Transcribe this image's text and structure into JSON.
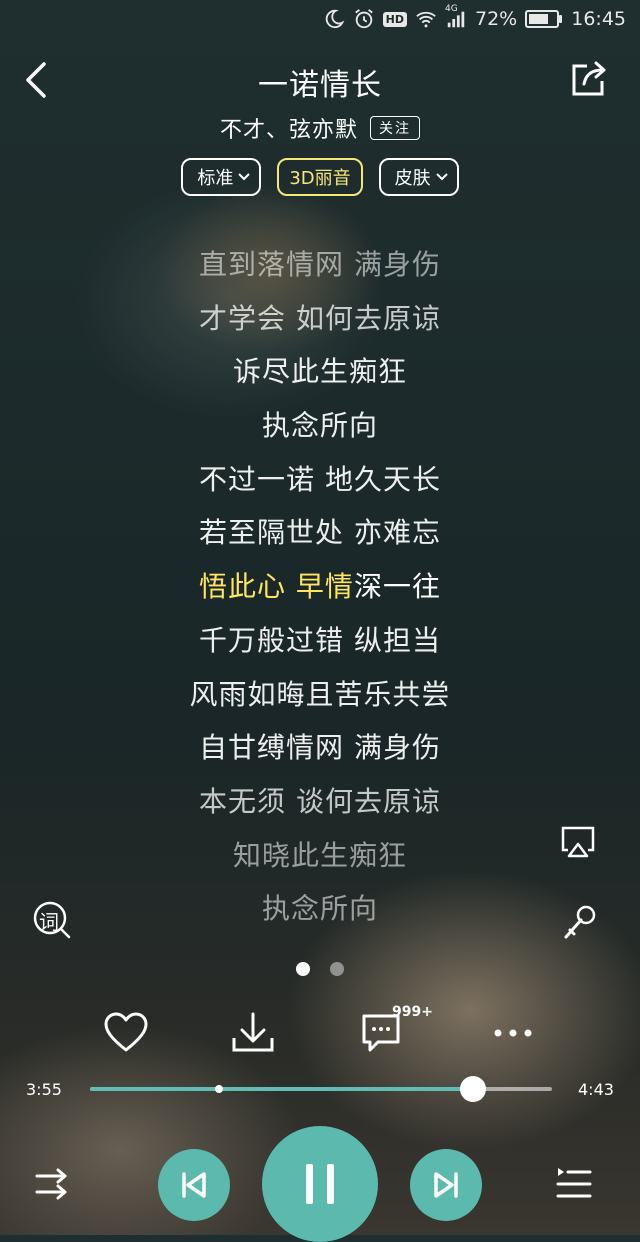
{
  "status_bar": {
    "battery": "72%",
    "network": "4G",
    "time": "16:45",
    "hd_badge": "HD",
    "battery_level": 0.72
  },
  "header": {
    "title": "一诺情长",
    "artist": "不才、弦亦默",
    "follow_label": "关注"
  },
  "options": {
    "quality_label": "标准",
    "effect_label": "3D丽音",
    "skin_label": "皮肤"
  },
  "lyrics": [
    "直到落情网 满身伤",
    "才学会 如何去原谅",
    "诉尽此生痴狂",
    "执念所向",
    "不过一诺 地久天长",
    "若至隔世处 亦难忘",
    "悟此心 早情深一往",
    "千万般过错 纵担当",
    "风雨如晦且苦乐共尝",
    "自甘缚情网 满身伤",
    "本无须 谈何去原谅",
    "知晓此生痴狂",
    "执念所向"
  ],
  "current_line": {
    "highlighted": "悟此心 早情",
    "rest": "深一往"
  },
  "lyric_icon_label": "词",
  "comment_badge": "999+",
  "playback": {
    "elapsed": "3:55",
    "total": "4:43",
    "progress": 0.83,
    "buffered": 0.28
  },
  "page_indicator": {
    "count": 2,
    "active": 0
  },
  "colors": {
    "accent": "#5bb9ae",
    "highlight": "#ffe65c",
    "effect_pill": "#f5e77a"
  },
  "icons": [
    "back-icon",
    "share-icon",
    "lyric-icon",
    "airplay-icon",
    "microphone-icon",
    "heart-icon",
    "download-icon",
    "comment-icon",
    "more-icon",
    "shuffle-icon",
    "previous-icon",
    "pause-icon",
    "next-icon",
    "playlist-icon"
  ]
}
